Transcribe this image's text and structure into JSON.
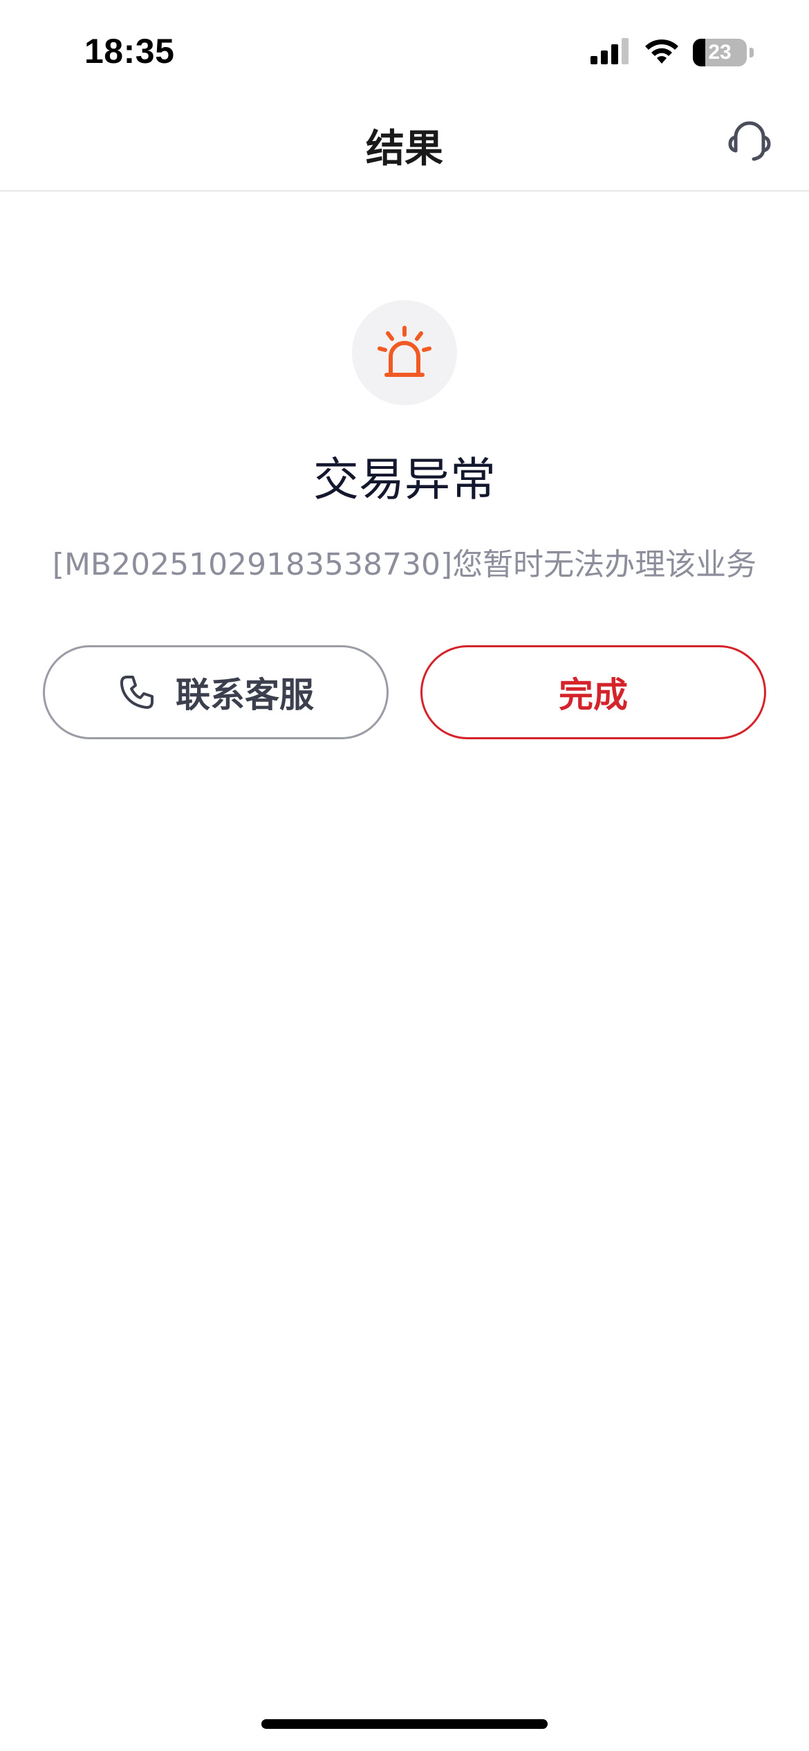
{
  "status_bar": {
    "time": "18:35",
    "battery_percent": 23,
    "battery_label": "23",
    "icons": [
      "signal-icon",
      "wifi-icon",
      "battery-icon"
    ]
  },
  "nav": {
    "title": "结果",
    "right_icon": "headset-icon"
  },
  "result": {
    "icon": "alarm-light-icon",
    "icon_color": "#f15a22",
    "title": "交易异常",
    "message": "[MB20251029183538730]您暂时无法办理该业务"
  },
  "actions": {
    "contact_label": "联系客服",
    "contact_icon": "phone-icon",
    "done_label": "完成",
    "done_color": "#d4232b"
  }
}
